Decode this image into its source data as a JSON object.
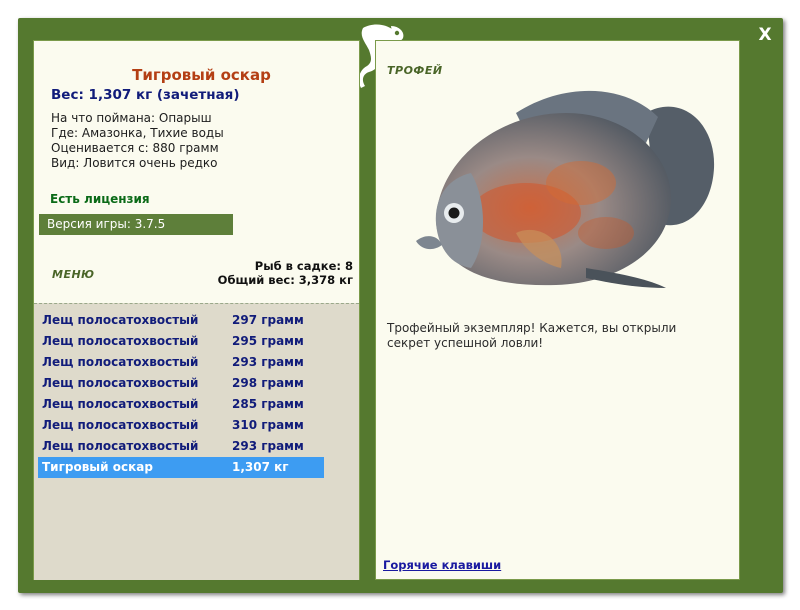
{
  "window": {
    "close_label": "X"
  },
  "fish": {
    "title": "Тигровый оскар",
    "weight_line": "Вес: 1,307 кг (зачетная)",
    "info": [
      "На что поймана: Опарыш",
      "Где: Амазонка, Тихие воды",
      "Оценивается с: 880 грамм",
      "Вид: Ловится очень редко"
    ]
  },
  "license": "Есть лицензия",
  "version": "Версия игры: 3.7.5",
  "menu_label": "МЕНЮ",
  "stats": {
    "fish_in_cage": "Рыб в садке: 8",
    "total_weight": "Общий вес: 3,378 кг"
  },
  "catches": [
    {
      "name": "Лещ полосатохвостый",
      "weight": "297 грамм"
    },
    {
      "name": "Лещ полосатохвостый",
      "weight": "295 грамм"
    },
    {
      "name": "Лещ полосатохвостый",
      "weight": "293 грамм"
    },
    {
      "name": "Лещ полосатохвостый",
      "weight": "298 грамм"
    },
    {
      "name": "Лещ полосатохвостый",
      "weight": "285 грамм"
    },
    {
      "name": "Лещ полосатохвостый",
      "weight": "310 грамм"
    },
    {
      "name": "Лещ полосатохвостый",
      "weight": "293 грамм"
    },
    {
      "name": "Тигровый оскар",
      "weight": "1,307 кг"
    }
  ],
  "trophy": {
    "label": "ТРОФЕЙ",
    "description": "Трофейный экземпляр! Кажется, вы открыли секрет успешной ловли!"
  },
  "hotkeys_label": "Горячие клавиши",
  "colors": {
    "window_green": "#55792f",
    "panel_bg": "#fbfbef",
    "selection_blue": "#3d9cf2",
    "title_orange": "#b43f14",
    "text_navy": "#111c7a"
  },
  "icons": [
    "chameleon-logo-icon",
    "close-icon",
    "tiger-oscar-fish-image"
  ]
}
